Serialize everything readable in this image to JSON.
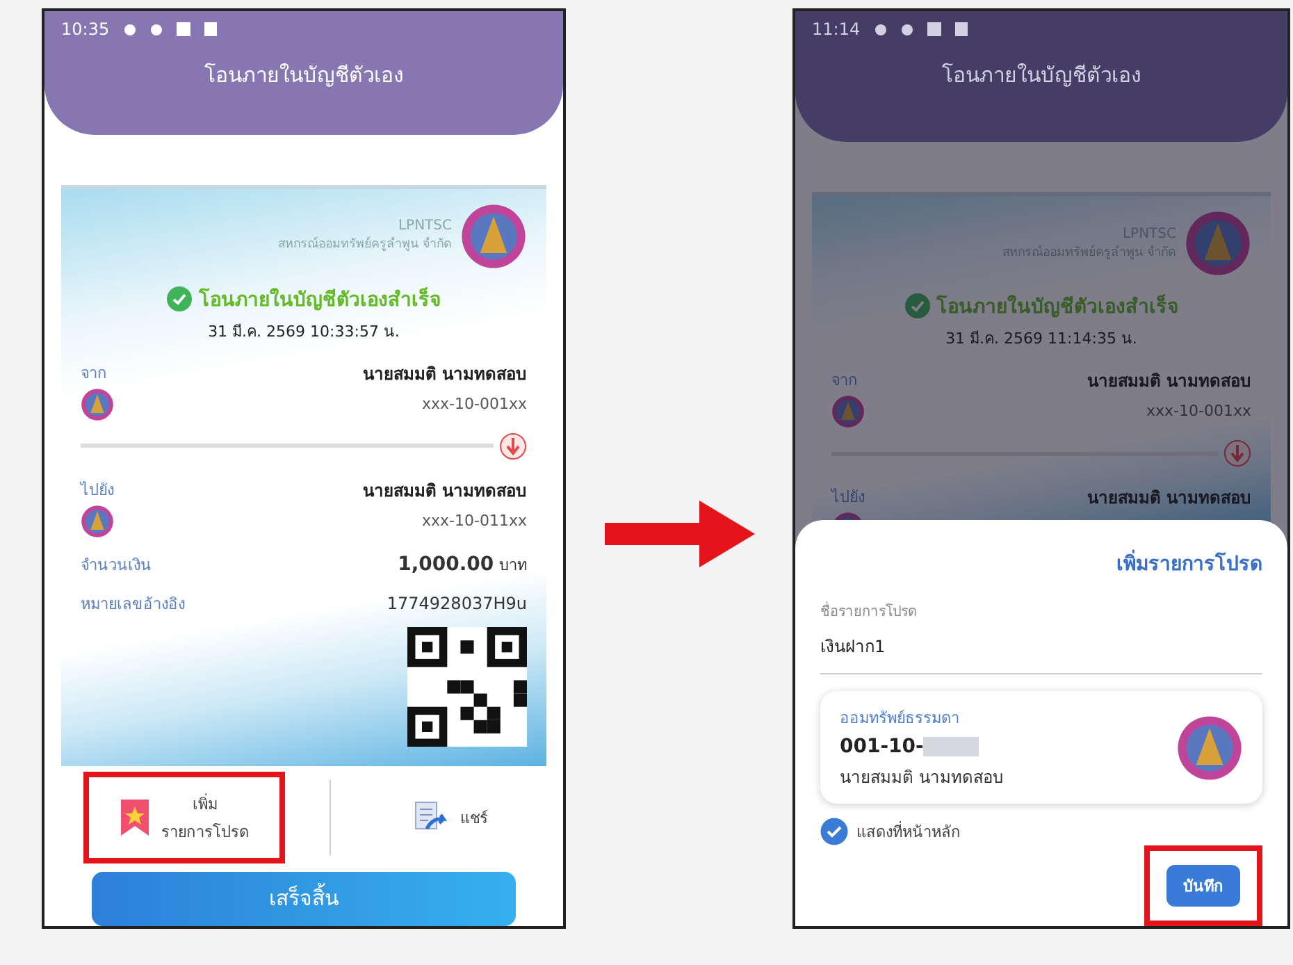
{
  "phones": [
    {
      "kind": "receipt",
      "dimmed": false,
      "status_bar": {
        "time": "10:35"
      },
      "header": {
        "title": "โอนภายในบัญชีตัวเอง"
      },
      "receipt": {
        "org_code": "LPNTSC",
        "org_name": "สหกรณ์ออมทรัพย์ครูลำพูน จำกัด",
        "status": "โอนภายในบัญชีตัวเองสำเร็จ",
        "datetime": "31 มี.ค. 2569 10:33:57 น.",
        "from": {
          "label": "จาก",
          "name": "นายสมมติ นามทดสอบ",
          "account": "xxx-10-001xx"
        },
        "to": {
          "label": "ไปยัง",
          "name": "นายสมมติ นามทดสอบ",
          "account": "xxx-10-011xx"
        },
        "amount": {
          "label": "จำนวนเงิน",
          "value": "1,000.00",
          "unit": "บาท"
        },
        "reference": {
          "label": "หมายเลขอ้างอิง",
          "value": "1774928037H9u"
        }
      },
      "actions": [
        {
          "kind": "favorite",
          "line1": "เพิ่ม",
          "line2": "รายการโปรด",
          "highlighted": true
        },
        {
          "kind": "share",
          "line1": "แชร์",
          "highlighted": false
        }
      ],
      "done_button": "เสร็จสิ้น"
    },
    {
      "kind": "sheet",
      "dimmed": true,
      "status_bar": {
        "time": "11:14"
      },
      "header": {
        "title": "โอนภายในบัญชีตัวเอง"
      },
      "receipt": {
        "org_code": "LPNTSC",
        "org_name": "สหกรณ์ออมทรัพย์ครูลำพูน จำกัด",
        "status": "โอนภายในบัญชีตัวเองสำเร็จ",
        "datetime": "31 มี.ค. 2569 11:14:35 น.",
        "from": {
          "label": "จาก",
          "name": "นายสมมติ นามทดสอบ",
          "account": "xxx-10-001xx"
        },
        "to": {
          "label": "ไปยัง",
          "name": "นายสมมติ นามทดสอบ"
        }
      },
      "sheet": {
        "title": "เพิ่มรายการโปรด",
        "field": {
          "label": "ชื่อรายการโปรด",
          "value": "เงินฝาก1"
        },
        "account": {
          "type": "ออมทรัพย์ธรรมดา",
          "number": "001-10-",
          "name": "นายสมมติ นามทดสอบ"
        },
        "show_on_home": {
          "label": "แสดงที่หน้าหลัก",
          "checked": true
        },
        "save_button": {
          "label": "บันทึก",
          "highlighted": true
        }
      }
    }
  ]
}
